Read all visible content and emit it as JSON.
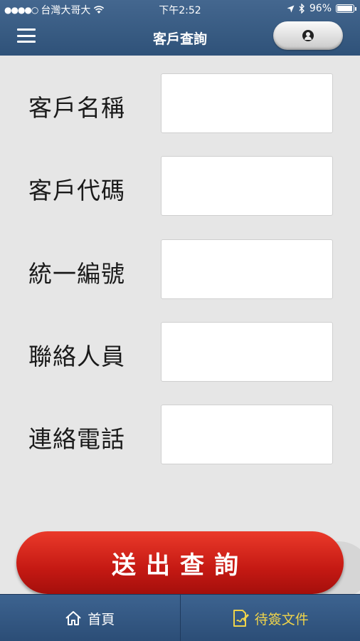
{
  "status_bar": {
    "signal_dots": "●●●●○",
    "carrier": "台灣大哥大",
    "time": "下午2:52",
    "battery_percent": "96%",
    "battery_level": 0.96
  },
  "nav": {
    "title": "客戶查詢"
  },
  "form": {
    "fields": [
      {
        "label": "客戶名稱",
        "value": ""
      },
      {
        "label": "客戶代碼",
        "value": ""
      },
      {
        "label": "統一編號",
        "value": ""
      },
      {
        "label": "聯絡人員",
        "value": ""
      },
      {
        "label": "連絡電話",
        "value": ""
      }
    ],
    "submit_label": "送出查詢"
  },
  "tabbar": {
    "tabs": [
      {
        "label": "首頁",
        "icon": "home-icon",
        "active": false
      },
      {
        "label": "待簽文件",
        "icon": "document-sign-icon",
        "active": true
      }
    ],
    "active_color": "#f0d44a"
  },
  "colors": {
    "header": "#3a5d86",
    "submit": "#c51913"
  }
}
